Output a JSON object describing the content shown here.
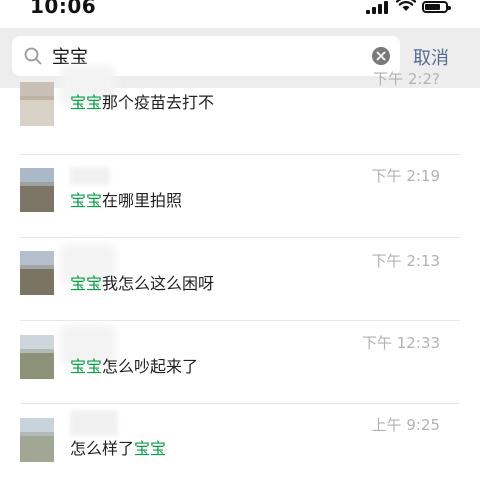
{
  "status_bar": {
    "time": "10:06"
  },
  "search": {
    "value": "宝宝",
    "cancel_label": "取消"
  },
  "results": [
    {
      "time": "下午 2:2?",
      "message_pre": "",
      "message_hl": "宝宝",
      "message_post": "那个疫苗去打不"
    },
    {
      "time": "下午 2:19",
      "message_pre": "",
      "message_hl": "宝宝",
      "message_post": "在哪里拍照"
    },
    {
      "time": "下午 2:13",
      "message_pre": "",
      "message_hl": "宝宝",
      "message_post": "我怎么这么困呀"
    },
    {
      "time": "下午 12:33",
      "message_pre": "",
      "message_hl": "宝宝",
      "message_post": "怎么吵起来了"
    },
    {
      "time": "上午 9:25",
      "message_pre": "怎么样了",
      "message_hl": "宝宝",
      "message_post": ""
    }
  ],
  "colors": {
    "highlight": "#07a046",
    "link": "#576b95",
    "timestamp": "#b2b2b2",
    "search_bg": "#ededed"
  }
}
